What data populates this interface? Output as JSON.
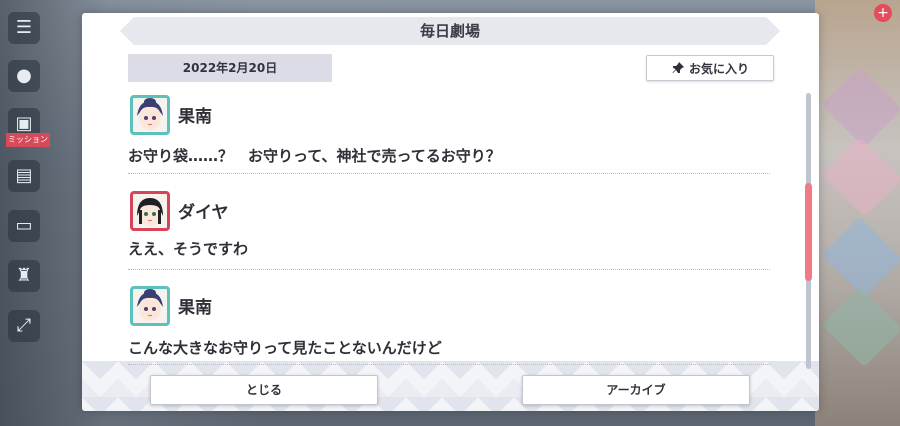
{
  "dialog": {
    "title": "毎日劇場",
    "date": "2022年2月20日",
    "favorite_label": "お気に入り",
    "close_label": "とじる",
    "archive_label": "アーカイブ"
  },
  "entries": [
    {
      "speaker": "果南",
      "text": "お守り袋……？　お守りって、神社で売ってるお守り？",
      "avatar": "kanan-avatar-icon"
    },
    {
      "speaker": "ダイヤ",
      "text": "ええ、そうですわ",
      "avatar": "dia-avatar-icon"
    },
    {
      "speaker": "果南",
      "text": "こんな大きなお守りって見たことないんだけど",
      "avatar": "kanan-avatar-icon"
    }
  ],
  "background": {
    "side_badge": "ミッション"
  },
  "colors": {
    "kanan_frame": "#5cc0bd",
    "dia_frame": "#d8435a",
    "scroll_thumb": "#ee7b85"
  }
}
